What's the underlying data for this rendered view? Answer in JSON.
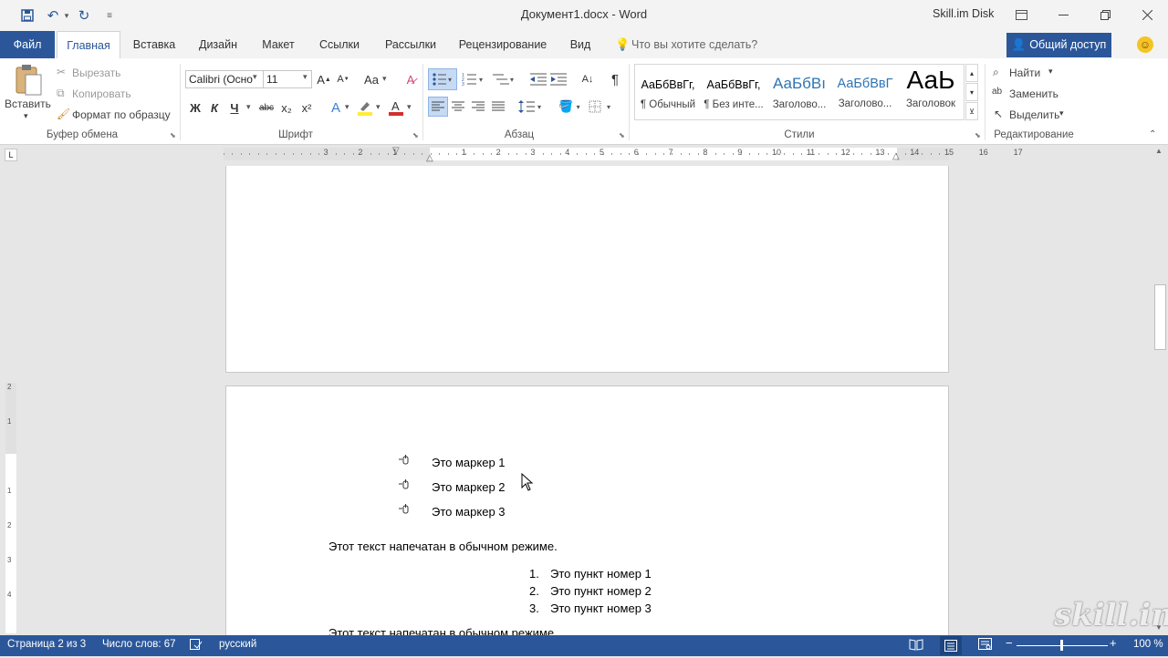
{
  "window": {
    "title": "Документ1.docx  -  Word",
    "disk": "Skill.im Disk"
  },
  "tabs": {
    "file": "Файл",
    "home": "Главная",
    "insert": "Вставка",
    "design": "Дизайн",
    "layout": "Макет",
    "references": "Ссылки",
    "mailings": "Рассылки",
    "review": "Рецензирование",
    "view": "Вид",
    "tell_me": "Что вы хотите сделать?",
    "share": "Общий доступ"
  },
  "clipboard": {
    "paste": "Вставить",
    "cut": "Вырезать",
    "copy": "Копировать",
    "format_painter": "Формат по образцу",
    "label": "Буфер обмена"
  },
  "font": {
    "name": "Calibri (Осно",
    "size": "11",
    "label": "Шрифт",
    "bold": "Ж",
    "italic": "К",
    "underline": "Ч",
    "strike": "abc",
    "sub": "x₂",
    "sup": "x²",
    "case": "Aa"
  },
  "paragraph": {
    "label": "Абзац"
  },
  "styles": {
    "label": "Стили",
    "items": [
      {
        "sample": "АаБбВвГг,",
        "name": "¶ Обычный"
      },
      {
        "sample": "АаБбВвГг,",
        "name": "¶ Без инте..."
      },
      {
        "sample": "АаБбВı",
        "name": "Заголово..."
      },
      {
        "sample": "АаБбВвГ",
        "name": "Заголово..."
      },
      {
        "sample": "АаЬ",
        "name": "Заголовок"
      }
    ]
  },
  "editing": {
    "find": "Найти",
    "replace": "Заменить",
    "select": "Выделить",
    "label": "Редактирование"
  },
  "ruler": {
    "ticks": [
      "3",
      "2",
      "1",
      "1",
      "2",
      "3",
      "4",
      "5",
      "6",
      "7",
      "8",
      "9",
      "10",
      "11",
      "12",
      "13",
      "14",
      "15",
      "16",
      "17"
    ]
  },
  "document": {
    "bullets": [
      "Это маркер 1",
      "Это маркер 2",
      "Это маркер 3"
    ],
    "plain_text": "Этот текст напечатан в обычном режиме.",
    "numbered": [
      {
        "num": "1.",
        "text": "Это пункт номер 1"
      },
      {
        "num": "2.",
        "text": "Это пункт номер 2"
      },
      {
        "num": "3.",
        "text": "Это пункт номер 3"
      }
    ],
    "cut_text": "Этот текст напечатан в обычном режиме."
  },
  "status": {
    "page": "Страница 2 из 3",
    "words": "Число слов: 67",
    "language": "русский",
    "zoom": "100 %"
  },
  "watermark": "skill.im",
  "colors": {
    "accent": "#2b579a",
    "font_color": "#d32f2f",
    "highlight": "#ffeb3b"
  }
}
